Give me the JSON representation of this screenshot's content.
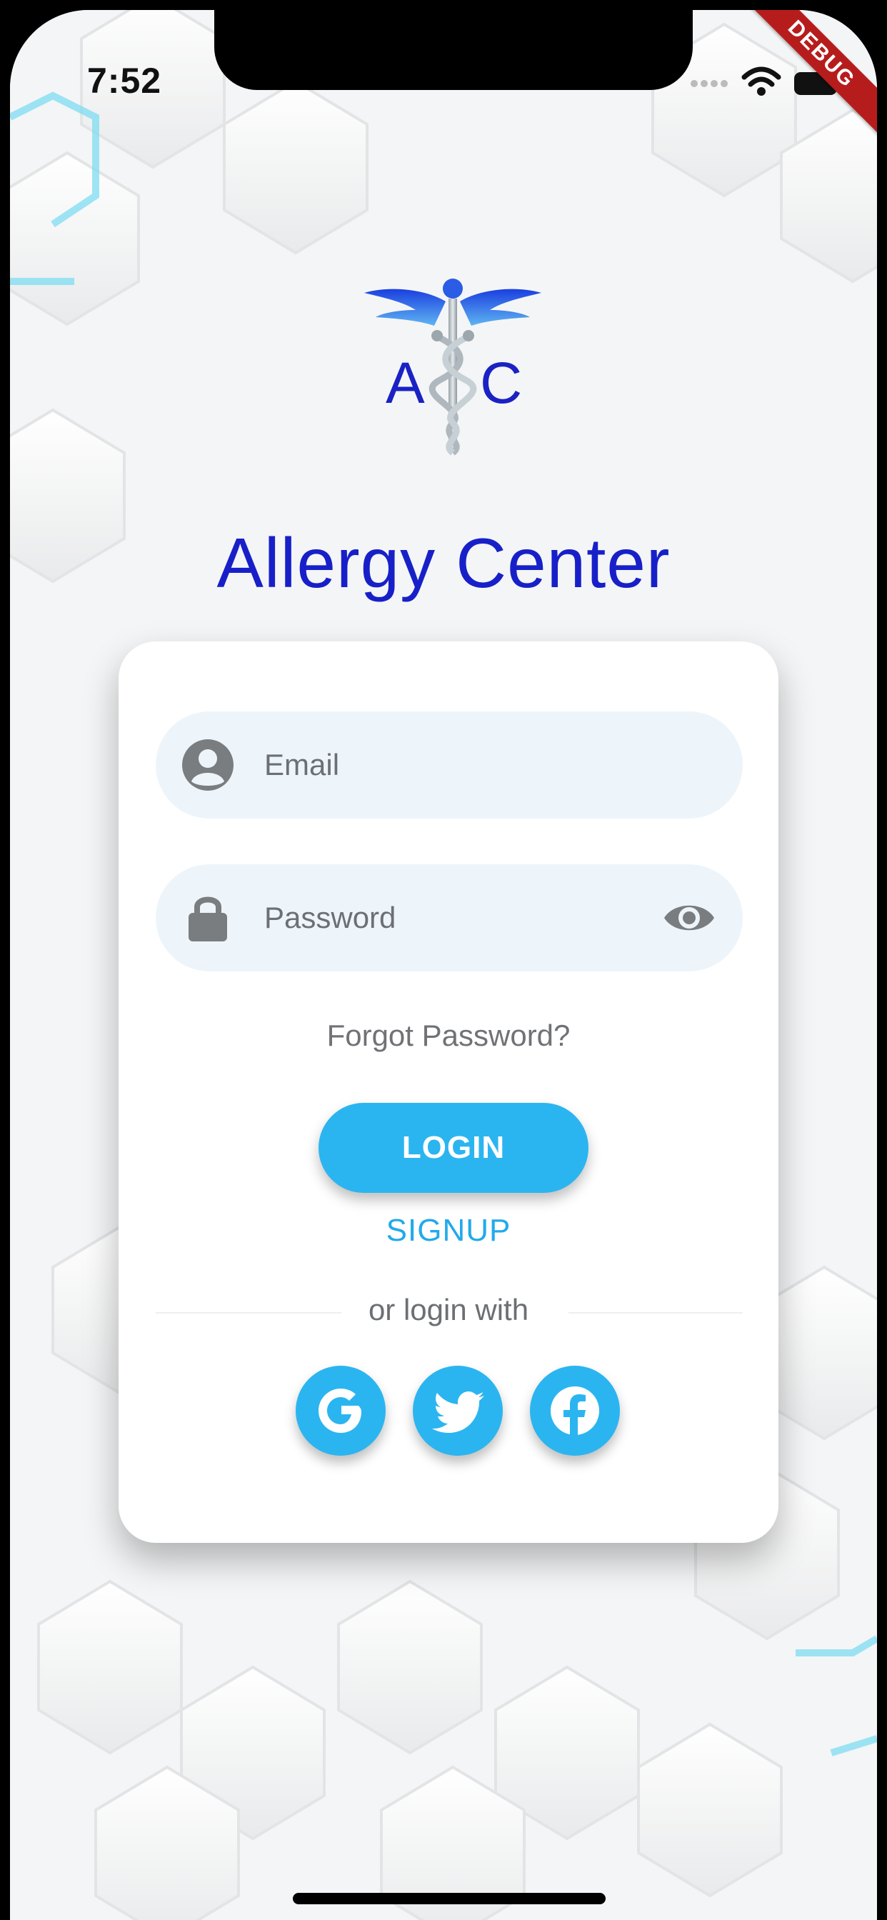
{
  "status_bar": {
    "time": "7:52",
    "debug_banner": "DEBUG"
  },
  "logo": {
    "text_left": "A",
    "text_right": "C",
    "icon": "caduceus-icon"
  },
  "app": {
    "title": "Allergy Center"
  },
  "login_form": {
    "email_placeholder": "Email",
    "password_placeholder": "Password",
    "forgot_password": "Forgot Password?",
    "login_button": "LOGIN",
    "signup_link": "SIGNUP",
    "divider_text": "or login with"
  },
  "social_logins": [
    {
      "icon": "google-icon"
    },
    {
      "icon": "twitter-icon"
    },
    {
      "icon": "facebook-icon"
    }
  ],
  "colors": {
    "title": "#1720c8",
    "accent": "#2bb5f0",
    "field_bg": "#edf5fb",
    "icon_gray": "#7a7d80"
  }
}
